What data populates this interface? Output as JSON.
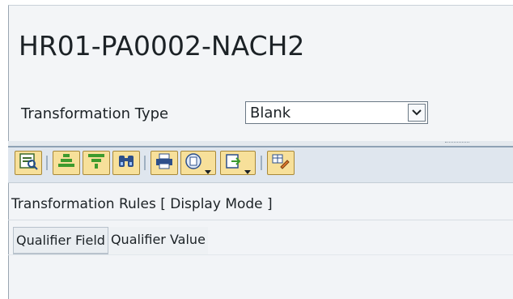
{
  "header": {
    "title": "HR01-PA0002-NACH2",
    "transformation_type_label": "Transformation Type",
    "transformation_type_value": "Blank"
  },
  "toolbar": {
    "buttons": [
      {
        "name": "details-icon"
      },
      {
        "name": "sort-ascending-icon"
      },
      {
        "name": "filter-icon"
      },
      {
        "name": "find-icon"
      },
      {
        "name": "print-icon"
      },
      {
        "name": "view-icon"
      },
      {
        "name": "export-icon"
      },
      {
        "name": "change-layout-icon"
      }
    ]
  },
  "section": {
    "title": "Transformation Rules [ Display Mode ]"
  },
  "table": {
    "columns": [
      "Qualifier Field",
      "Qualifier Value"
    ]
  },
  "colors": {
    "toolbar_bg": "#dfe6ee",
    "button_bg": "#f7e09a",
    "panel_bg": "#f3f5f7"
  }
}
